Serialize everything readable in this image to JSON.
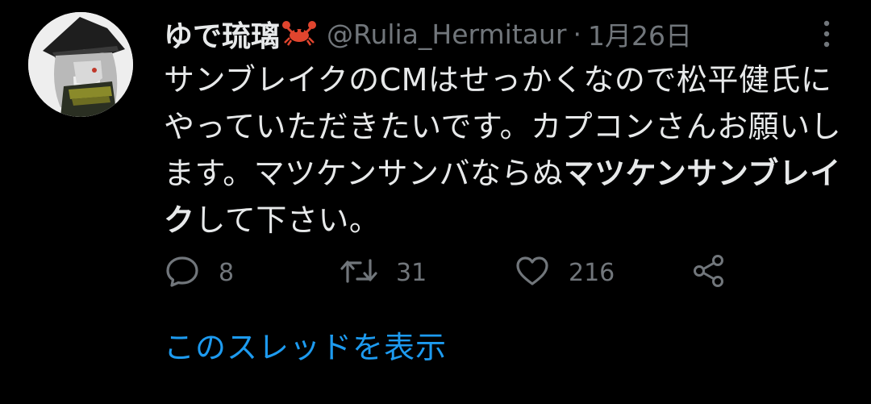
{
  "tweet": {
    "display_name": "ゆで琉璃",
    "emoji": "crab-emoji",
    "handle": "@Rulia_Hermitaur",
    "separator": "·",
    "date": "1月26日",
    "text_parts": [
      {
        "text": "サンブレイクのCMはせっかくなので松平健氏にやっていただきたいです。カプコンさんお願いします。マツケンサンバならぬ",
        "bold": false
      },
      {
        "text": "マツケンサンブレイク",
        "bold": true
      },
      {
        "text": "して下さい。",
        "bold": false
      }
    ],
    "stats": {
      "replies": "8",
      "retweets": "31",
      "likes": "216"
    },
    "show_thread_label": "このスレッドを表示"
  },
  "icons": {
    "more": "vertical-ellipsis-icon",
    "reply": "speech-bubble-icon",
    "retweet": "retweet-arrows-icon",
    "like": "heart-outline-icon",
    "share": "share-nodes-icon"
  },
  "colors": {
    "background": "#000000",
    "text": "#e7e9ea",
    "secondary": "#71767b",
    "link": "#1d9bf0",
    "crab": "#e0452e"
  }
}
